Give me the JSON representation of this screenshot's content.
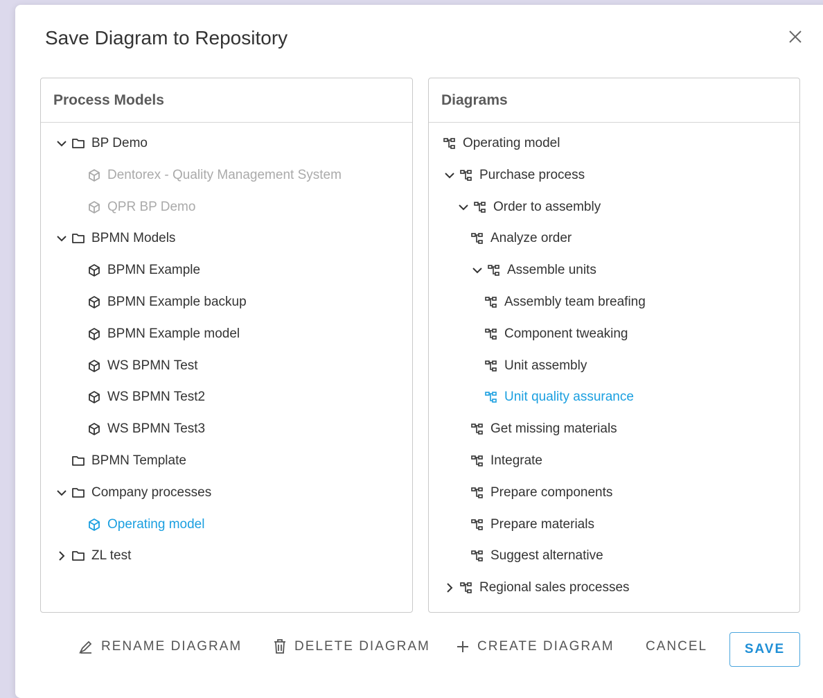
{
  "dialog": {
    "title": "Save Diagram to Repository"
  },
  "left_panel": {
    "header": "Process Models",
    "items": [
      {
        "label": "BP Demo",
        "type": "folder",
        "depth": 0,
        "caret": "down",
        "state": "normal"
      },
      {
        "label": "Dentorex - Quality Management System",
        "type": "model",
        "depth": 1,
        "caret": "none",
        "state": "dim"
      },
      {
        "label": "QPR BP Demo",
        "type": "model",
        "depth": 1,
        "caret": "none",
        "state": "dim"
      },
      {
        "label": "BPMN Models",
        "type": "folder",
        "depth": 0,
        "caret": "down",
        "state": "normal"
      },
      {
        "label": "BPMN Example",
        "type": "model",
        "depth": 1,
        "caret": "none",
        "state": "normal"
      },
      {
        "label": "BPMN Example backup",
        "type": "model",
        "depth": 1,
        "caret": "none",
        "state": "normal"
      },
      {
        "label": "BPMN Example model",
        "type": "model",
        "depth": 1,
        "caret": "none",
        "state": "normal"
      },
      {
        "label": "WS BPMN Test",
        "type": "model",
        "depth": 1,
        "caret": "none",
        "state": "normal"
      },
      {
        "label": "WS BPMN Test2",
        "type": "model",
        "depth": 1,
        "caret": "none",
        "state": "normal"
      },
      {
        "label": "WS BPMN Test3",
        "type": "model",
        "depth": 1,
        "caret": "none",
        "state": "normal"
      },
      {
        "label": "BPMN Template",
        "type": "folder",
        "depth": 0,
        "caret": "blank",
        "state": "normal"
      },
      {
        "label": "Company processes",
        "type": "folder",
        "depth": 0,
        "caret": "down",
        "state": "normal"
      },
      {
        "label": "Operating model",
        "type": "model",
        "depth": 1,
        "caret": "none",
        "state": "selected"
      },
      {
        "label": "ZL test",
        "type": "folder",
        "depth": 0,
        "caret": "right",
        "state": "normal"
      }
    ]
  },
  "right_panel": {
    "header": "Diagrams",
    "items": [
      {
        "label": "Operating model",
        "depth": 0,
        "caret": "none",
        "state": "normal"
      },
      {
        "label": "Purchase process",
        "depth": 0,
        "caret": "down",
        "state": "normal"
      },
      {
        "label": "Order to assembly",
        "depth": 1,
        "caret": "down",
        "state": "normal"
      },
      {
        "label": "Analyze order",
        "depth": 2,
        "caret": "none",
        "state": "normal"
      },
      {
        "label": "Assemble units",
        "depth": 2,
        "caret": "down",
        "state": "normal"
      },
      {
        "label": "Assembly team breafing",
        "depth": 3,
        "caret": "none",
        "state": "normal"
      },
      {
        "label": "Component tweaking",
        "depth": 3,
        "caret": "none",
        "state": "normal"
      },
      {
        "label": "Unit assembly",
        "depth": 3,
        "caret": "none",
        "state": "normal"
      },
      {
        "label": "Unit quality assurance",
        "depth": 3,
        "caret": "none",
        "state": "selected"
      },
      {
        "label": "Get missing materials",
        "depth": 2,
        "caret": "none",
        "state": "normal"
      },
      {
        "label": "Integrate",
        "depth": 2,
        "caret": "none",
        "state": "normal"
      },
      {
        "label": "Prepare components",
        "depth": 2,
        "caret": "none",
        "state": "normal"
      },
      {
        "label": "Prepare materials",
        "depth": 2,
        "caret": "none",
        "state": "normal"
      },
      {
        "label": "Suggest alternative",
        "depth": 2,
        "caret": "none",
        "state": "normal"
      },
      {
        "label": "Regional sales processes",
        "depth": 0,
        "caret": "right",
        "state": "normal"
      }
    ]
  },
  "footer": {
    "rename_label": "RENAME DIAGRAM",
    "delete_label": "DELETE DIAGRAM",
    "create_label": "CREATE DIAGRAM",
    "cancel_label": "CANCEL",
    "save_label": "SAVE"
  },
  "icons": {
    "close": "close-icon",
    "folder": "folder-icon",
    "model": "cube-icon",
    "diagram": "diagram-icon",
    "rename": "pencil-icon",
    "delete": "trash-icon",
    "create": "plus-icon"
  },
  "colors": {
    "accent": "#1a9fe0",
    "dim": "#aaaaaa",
    "text": "#333333"
  }
}
